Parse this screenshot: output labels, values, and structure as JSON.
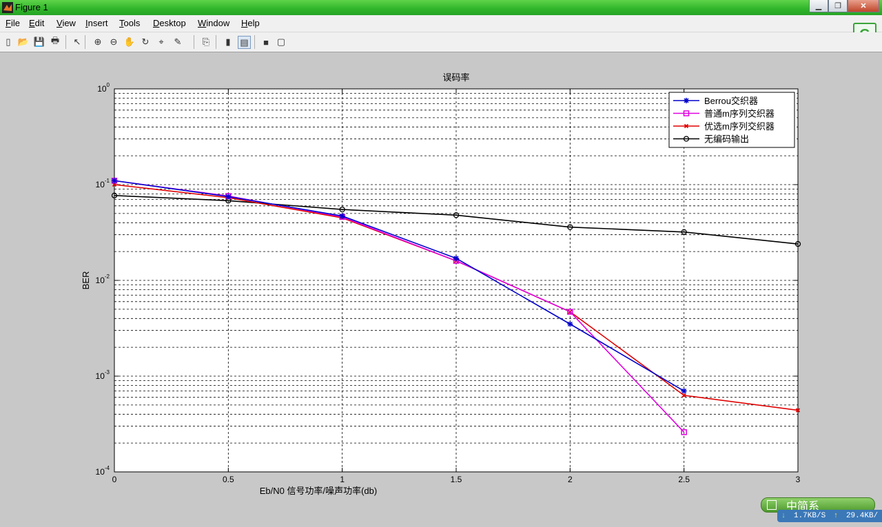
{
  "window": {
    "title": "Figure 1"
  },
  "menu": [
    "File",
    "Edit",
    "View",
    "Insert",
    "Tools",
    "Desktop",
    "Window",
    "Help"
  ],
  "menu_underline": [
    "F",
    "E",
    "V",
    "I",
    "T",
    "D",
    "W",
    "H"
  ],
  "toolbar": {
    "icons": [
      "new-figure-icon",
      "open-file-icon",
      "save-icon",
      "print-icon",
      "select-arrow-icon",
      "zoom-in-icon",
      "zoom-out-icon",
      "pan-hand-icon",
      "rotate-3d-icon",
      "data-cursor-icon",
      "brush-icon",
      "link-plot-icon",
      "colorbar-icon",
      "legend-icon",
      "hide-tools-icon",
      "dock-icon"
    ]
  },
  "ime": {
    "label": "中简系"
  },
  "net": {
    "down": "1.7KB/S",
    "up": "29.4KB/"
  },
  "chart_data": {
    "type": "line",
    "title": "误码率",
    "xlabel": "Eb/N0 信号功率/噪声功率(db)",
    "ylabel": "BER",
    "xlim": [
      0,
      3
    ],
    "ylim": [
      0.0001,
      1
    ],
    "yscale": "log",
    "grid": true,
    "legend_position": "top-right",
    "xticks": [
      "0",
      "0.5",
      "1",
      "1.5",
      "2",
      "2.5",
      "3"
    ],
    "yticks": [
      {
        "base": "10",
        "exp": "0"
      },
      {
        "base": "10",
        "exp": "-1"
      },
      {
        "base": "10",
        "exp": "-2"
      },
      {
        "base": "10",
        "exp": "-3"
      },
      {
        "base": "10",
        "exp": "-4"
      }
    ],
    "series": [
      {
        "name": "Berrou交织器",
        "color": "#0000cc",
        "marker": "star",
        "x": [
          0,
          0.5,
          1,
          1.5,
          2,
          2.5
        ],
        "y": [
          0.11,
          0.075,
          0.047,
          0.017,
          0.0035,
          0.0007
        ]
      },
      {
        "name": "普通m序列交织器",
        "color": "#e000e0",
        "marker": "square",
        "x": [
          0,
          0.5,
          1,
          1.5,
          2,
          2.5
        ],
        "y": [
          0.11,
          0.076,
          0.046,
          0.016,
          0.0047,
          0.00026
        ]
      },
      {
        "name": "优选m序列交织器",
        "color": "#e00000",
        "marker": "x",
        "x": [
          0,
          0.5,
          1,
          1.5,
          2,
          2.5,
          3
        ],
        "y": [
          0.1,
          0.073,
          0.045,
          0.016,
          0.0047,
          0.00063,
          0.00044
        ]
      },
      {
        "name": "无编码输出",
        "color": "#000000",
        "marker": "circle",
        "x": [
          0,
          0.5,
          1,
          1.5,
          2,
          2.5,
          3
        ],
        "y": [
          0.077,
          0.068,
          0.055,
          0.048,
          0.036,
          0.032,
          0.024
        ]
      }
    ]
  }
}
